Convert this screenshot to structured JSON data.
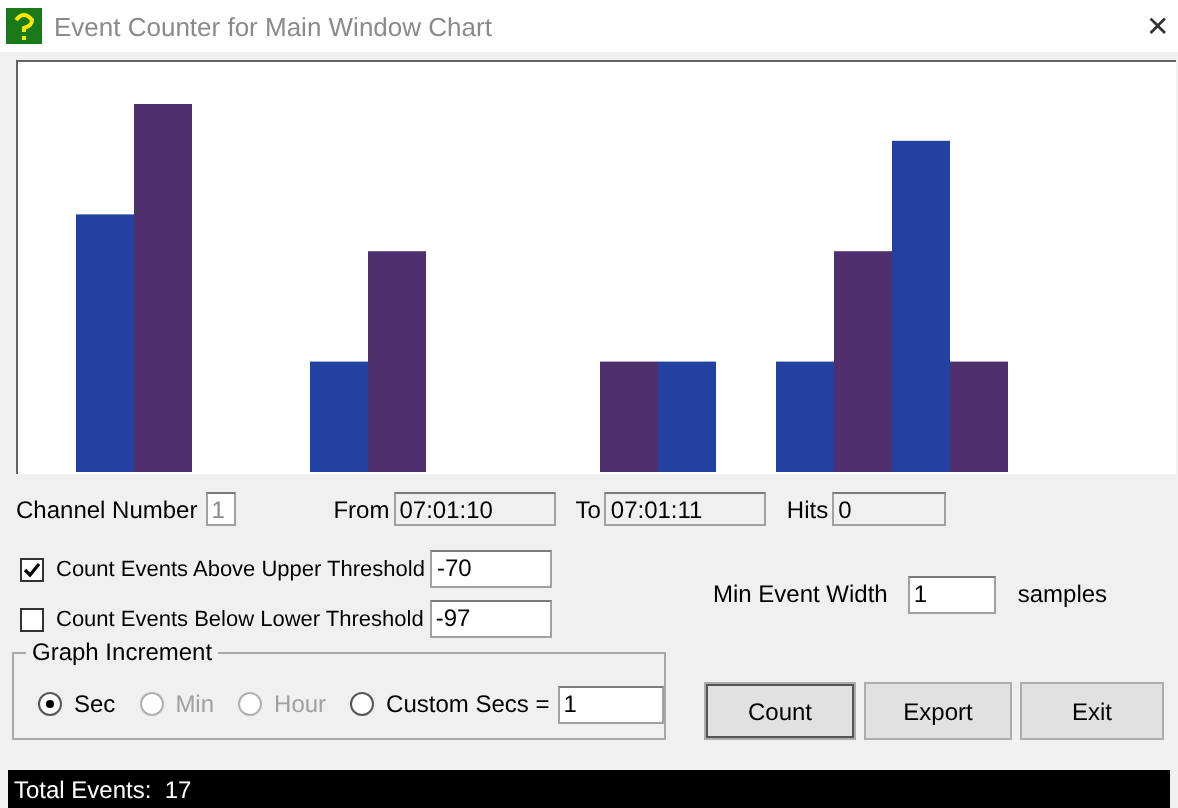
{
  "window": {
    "title": "Event Counter for Main Window Chart",
    "close": "✕"
  },
  "channel": {
    "label": "Channel Number",
    "value": "1",
    "disabled": true
  },
  "range": [
    {
      "label": "From",
      "value": "07:01:10"
    },
    {
      "label": "To",
      "value": "07:01:11"
    },
    {
      "label": "Hits",
      "value": "0"
    }
  ],
  "thresholds": [
    {
      "label": "Count Events Above Upper Threshold",
      "checked": true,
      "value": "-70"
    },
    {
      "label": "Count Events Below Lower Threshold",
      "checked": false,
      "value": "-97"
    }
  ],
  "min_event_width": {
    "label": "Min Event Width",
    "value": "1",
    "unit": "samples"
  },
  "graph_increment": {
    "title": "Graph Increment",
    "custom_value": "1",
    "options": [
      {
        "label": "Sec",
        "selected": true,
        "disabled": false
      },
      {
        "label": "Min",
        "selected": false,
        "disabled": true
      },
      {
        "label": "Hour",
        "selected": false,
        "disabled": true
      },
      {
        "label": "Custom Secs =",
        "selected": false,
        "disabled": false
      }
    ]
  },
  "buttons": [
    "Count",
    "Export",
    "Exit"
  ],
  "status_bar": {
    "text": "Total Events:  17"
  }
}
